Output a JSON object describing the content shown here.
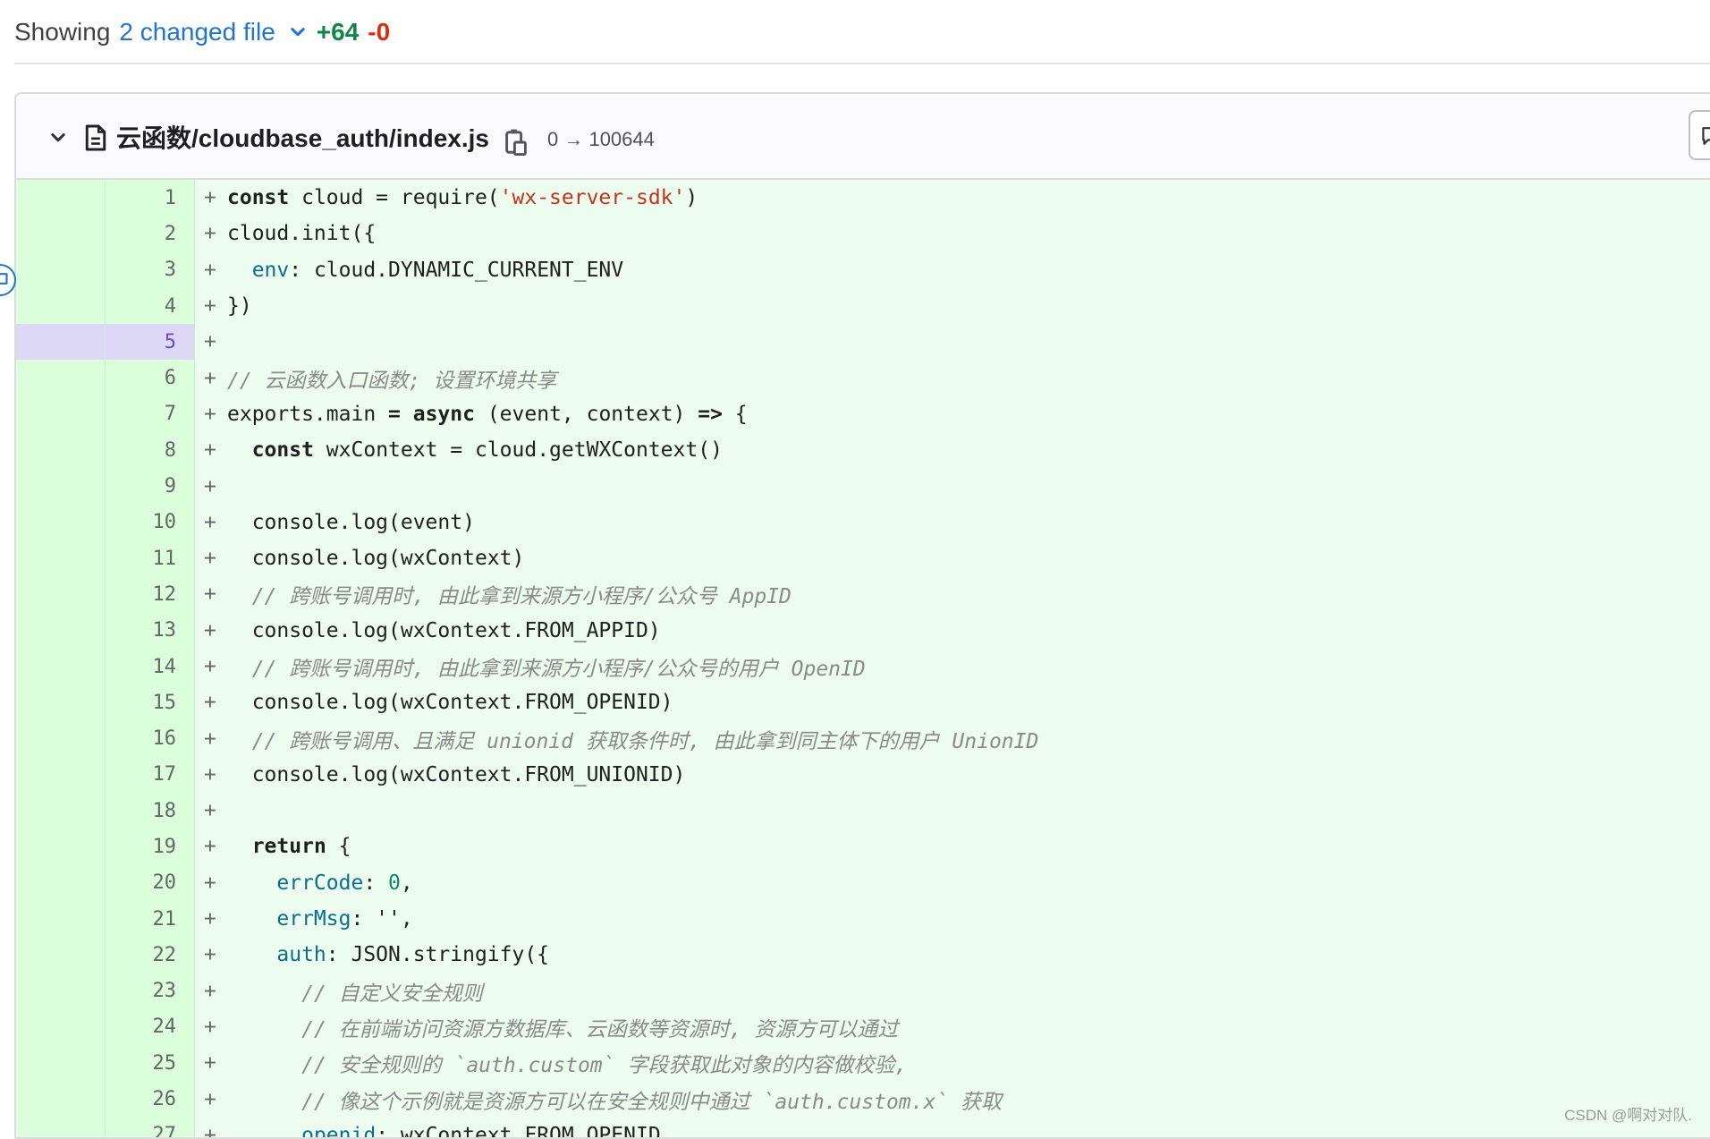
{
  "summary": {
    "showing": "Showing",
    "changed": "2 changed file",
    "additions": "+64",
    "deletions": "-0"
  },
  "file": {
    "path": "云函数/cloudbase_auth/index.js",
    "mode": "0 → 100644",
    "icons": [
      "chevron-down-icon",
      "file-icon",
      "copy-icon",
      "comment-icon"
    ]
  },
  "diff_lines": [
    {
      "n": "1",
      "prefix": "+",
      "code": [
        [
          "kw",
          "const"
        ],
        [
          "t",
          " cloud = require("
        ],
        [
          "str",
          "'wx-server-sdk'"
        ],
        [
          "t",
          ")"
        ]
      ]
    },
    {
      "n": "2",
      "prefix": "+",
      "code": [
        [
          "t",
          "cloud.init({"
        ]
      ]
    },
    {
      "n": "3",
      "prefix": "+",
      "code": [
        [
          "t",
          "  "
        ],
        [
          "prop",
          "env"
        ],
        [
          "t",
          ": cloud.DYNAMIC_CURRENT_ENV"
        ]
      ]
    },
    {
      "n": "4",
      "prefix": "+",
      "code": [
        [
          "t",
          "})"
        ]
      ]
    },
    {
      "n": "5",
      "prefix": "+",
      "code": [],
      "highlight": true
    },
    {
      "n": "6",
      "prefix": "+",
      "code": [
        [
          "cmt",
          "// 云函数入口函数; 设置环境共享"
        ]
      ]
    },
    {
      "n": "7",
      "prefix": "+",
      "code": [
        [
          "t",
          "exports.main "
        ],
        [
          "kw",
          "="
        ],
        [
          "t",
          " "
        ],
        [
          "kw",
          "async"
        ],
        [
          "t",
          " (event, context) "
        ],
        [
          "kw",
          "=>"
        ],
        [
          "t",
          " {"
        ]
      ]
    },
    {
      "n": "8",
      "prefix": "+",
      "code": [
        [
          "t",
          "  "
        ],
        [
          "kw",
          "const"
        ],
        [
          "t",
          " wxContext = cloud.getWXContext()"
        ]
      ]
    },
    {
      "n": "9",
      "prefix": "+",
      "code": []
    },
    {
      "n": "10",
      "prefix": "+",
      "code": [
        [
          "t",
          "  console.log(event)"
        ]
      ]
    },
    {
      "n": "11",
      "prefix": "+",
      "code": [
        [
          "t",
          "  console.log(wxContext)"
        ]
      ]
    },
    {
      "n": "12",
      "prefix": "+",
      "code": [
        [
          "t",
          "  "
        ],
        [
          "cmt",
          "// 跨账号调用时, 由此拿到来源方小程序/公众号 AppID"
        ]
      ]
    },
    {
      "n": "13",
      "prefix": "+",
      "code": [
        [
          "t",
          "  console.log(wxContext.FROM_APPID)"
        ]
      ]
    },
    {
      "n": "14",
      "prefix": "+",
      "code": [
        [
          "t",
          "  "
        ],
        [
          "cmt",
          "// 跨账号调用时, 由此拿到来源方小程序/公众号的用户 OpenID"
        ]
      ]
    },
    {
      "n": "15",
      "prefix": "+",
      "code": [
        [
          "t",
          "  console.log(wxContext.FROM_OPENID)"
        ]
      ]
    },
    {
      "n": "16",
      "prefix": "+",
      "code": [
        [
          "t",
          "  "
        ],
        [
          "cmt",
          "// 跨账号调用、且满足 unionid 获取条件时, 由此拿到同主体下的用户 UnionID"
        ]
      ]
    },
    {
      "n": "17",
      "prefix": "+",
      "code": [
        [
          "t",
          "  console.log(wxContext.FROM_UNIONID)"
        ]
      ]
    },
    {
      "n": "18",
      "prefix": "+",
      "code": []
    },
    {
      "n": "19",
      "prefix": "+",
      "code": [
        [
          "t",
          "  "
        ],
        [
          "kw",
          "return"
        ],
        [
          "t",
          " {"
        ]
      ]
    },
    {
      "n": "20",
      "prefix": "+",
      "code": [
        [
          "t",
          "    "
        ],
        [
          "prop",
          "errCode"
        ],
        [
          "t",
          ": "
        ],
        [
          "num",
          "0"
        ],
        [
          "t",
          ","
        ]
      ]
    },
    {
      "n": "21",
      "prefix": "+",
      "code": [
        [
          "t",
          "    "
        ],
        [
          "prop",
          "errMsg"
        ],
        [
          "t",
          ": '',"
        ]
      ]
    },
    {
      "n": "22",
      "prefix": "+",
      "code": [
        [
          "t",
          "    "
        ],
        [
          "prop",
          "auth"
        ],
        [
          "t",
          ": JSON.stringify({"
        ]
      ]
    },
    {
      "n": "23",
      "prefix": "+",
      "code": [
        [
          "t",
          "      "
        ],
        [
          "cmt",
          "// 自定义安全规则"
        ]
      ]
    },
    {
      "n": "24",
      "prefix": "+",
      "code": [
        [
          "t",
          "      "
        ],
        [
          "cmt",
          "// 在前端访问资源方数据库、云函数等资源时, 资源方可以通过"
        ]
      ]
    },
    {
      "n": "25",
      "prefix": "+",
      "code": [
        [
          "t",
          "      "
        ],
        [
          "cmt",
          "// 安全规则的 `auth.custom` 字段获取此对象的内容做校验,"
        ]
      ]
    },
    {
      "n": "26",
      "prefix": "+",
      "code": [
        [
          "t",
          "      "
        ],
        [
          "cmt",
          "// 像这个示例就是资源方可以在安全规则中通过 `auth.custom.x` 获取"
        ]
      ]
    },
    {
      "n": "27",
      "prefix": "+",
      "code": [
        [
          "t",
          "      "
        ],
        [
          "prop",
          "openid"
        ],
        [
          "t",
          ": wxContext.FROM_OPENID"
        ]
      ]
    }
  ],
  "watermark": "CSDN @啊对对队."
}
